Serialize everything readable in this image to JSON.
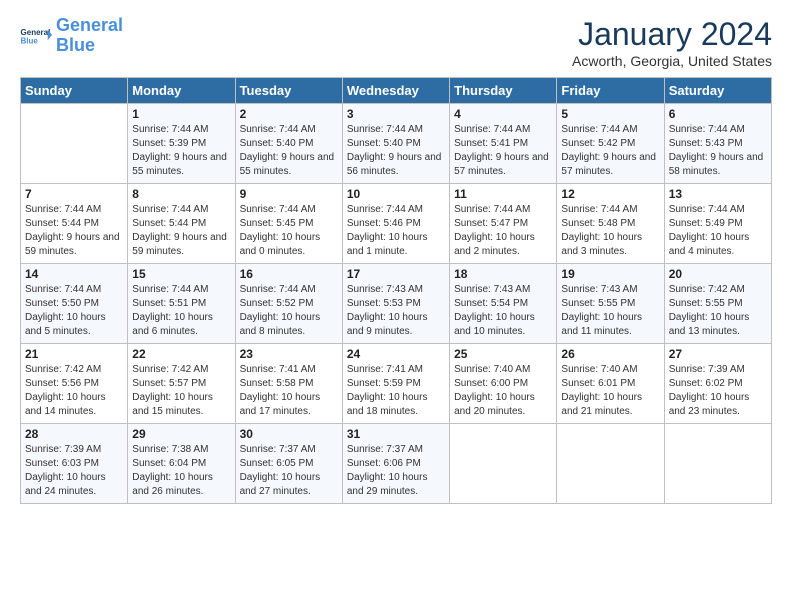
{
  "header": {
    "logo_line1": "General",
    "logo_line2": "Blue",
    "month_title": "January 2024",
    "location": "Acworth, Georgia, United States"
  },
  "weekdays": [
    "Sunday",
    "Monday",
    "Tuesday",
    "Wednesday",
    "Thursday",
    "Friday",
    "Saturday"
  ],
  "weeks": [
    [
      {
        "day": "",
        "sunrise": "",
        "sunset": "",
        "daylight": ""
      },
      {
        "day": "1",
        "sunrise": "Sunrise: 7:44 AM",
        "sunset": "Sunset: 5:39 PM",
        "daylight": "Daylight: 9 hours and 55 minutes."
      },
      {
        "day": "2",
        "sunrise": "Sunrise: 7:44 AM",
        "sunset": "Sunset: 5:40 PM",
        "daylight": "Daylight: 9 hours and 55 minutes."
      },
      {
        "day": "3",
        "sunrise": "Sunrise: 7:44 AM",
        "sunset": "Sunset: 5:40 PM",
        "daylight": "Daylight: 9 hours and 56 minutes."
      },
      {
        "day": "4",
        "sunrise": "Sunrise: 7:44 AM",
        "sunset": "Sunset: 5:41 PM",
        "daylight": "Daylight: 9 hours and 57 minutes."
      },
      {
        "day": "5",
        "sunrise": "Sunrise: 7:44 AM",
        "sunset": "Sunset: 5:42 PM",
        "daylight": "Daylight: 9 hours and 57 minutes."
      },
      {
        "day": "6",
        "sunrise": "Sunrise: 7:44 AM",
        "sunset": "Sunset: 5:43 PM",
        "daylight": "Daylight: 9 hours and 58 minutes."
      }
    ],
    [
      {
        "day": "7",
        "sunrise": "Sunrise: 7:44 AM",
        "sunset": "Sunset: 5:44 PM",
        "daylight": "Daylight: 9 hours and 59 minutes."
      },
      {
        "day": "8",
        "sunrise": "Sunrise: 7:44 AM",
        "sunset": "Sunset: 5:44 PM",
        "daylight": "Daylight: 9 hours and 59 minutes."
      },
      {
        "day": "9",
        "sunrise": "Sunrise: 7:44 AM",
        "sunset": "Sunset: 5:45 PM",
        "daylight": "Daylight: 10 hours and 0 minutes."
      },
      {
        "day": "10",
        "sunrise": "Sunrise: 7:44 AM",
        "sunset": "Sunset: 5:46 PM",
        "daylight": "Daylight: 10 hours and 1 minute."
      },
      {
        "day": "11",
        "sunrise": "Sunrise: 7:44 AM",
        "sunset": "Sunset: 5:47 PM",
        "daylight": "Daylight: 10 hours and 2 minutes."
      },
      {
        "day": "12",
        "sunrise": "Sunrise: 7:44 AM",
        "sunset": "Sunset: 5:48 PM",
        "daylight": "Daylight: 10 hours and 3 minutes."
      },
      {
        "day": "13",
        "sunrise": "Sunrise: 7:44 AM",
        "sunset": "Sunset: 5:49 PM",
        "daylight": "Daylight: 10 hours and 4 minutes."
      }
    ],
    [
      {
        "day": "14",
        "sunrise": "Sunrise: 7:44 AM",
        "sunset": "Sunset: 5:50 PM",
        "daylight": "Daylight: 10 hours and 5 minutes."
      },
      {
        "day": "15",
        "sunrise": "Sunrise: 7:44 AM",
        "sunset": "Sunset: 5:51 PM",
        "daylight": "Daylight: 10 hours and 6 minutes."
      },
      {
        "day": "16",
        "sunrise": "Sunrise: 7:44 AM",
        "sunset": "Sunset: 5:52 PM",
        "daylight": "Daylight: 10 hours and 8 minutes."
      },
      {
        "day": "17",
        "sunrise": "Sunrise: 7:43 AM",
        "sunset": "Sunset: 5:53 PM",
        "daylight": "Daylight: 10 hours and 9 minutes."
      },
      {
        "day": "18",
        "sunrise": "Sunrise: 7:43 AM",
        "sunset": "Sunset: 5:54 PM",
        "daylight": "Daylight: 10 hours and 10 minutes."
      },
      {
        "day": "19",
        "sunrise": "Sunrise: 7:43 AM",
        "sunset": "Sunset: 5:55 PM",
        "daylight": "Daylight: 10 hours and 11 minutes."
      },
      {
        "day": "20",
        "sunrise": "Sunrise: 7:42 AM",
        "sunset": "Sunset: 5:55 PM",
        "daylight": "Daylight: 10 hours and 13 minutes."
      }
    ],
    [
      {
        "day": "21",
        "sunrise": "Sunrise: 7:42 AM",
        "sunset": "Sunset: 5:56 PM",
        "daylight": "Daylight: 10 hours and 14 minutes."
      },
      {
        "day": "22",
        "sunrise": "Sunrise: 7:42 AM",
        "sunset": "Sunset: 5:57 PM",
        "daylight": "Daylight: 10 hours and 15 minutes."
      },
      {
        "day": "23",
        "sunrise": "Sunrise: 7:41 AM",
        "sunset": "Sunset: 5:58 PM",
        "daylight": "Daylight: 10 hours and 17 minutes."
      },
      {
        "day": "24",
        "sunrise": "Sunrise: 7:41 AM",
        "sunset": "Sunset: 5:59 PM",
        "daylight": "Daylight: 10 hours and 18 minutes."
      },
      {
        "day": "25",
        "sunrise": "Sunrise: 7:40 AM",
        "sunset": "Sunset: 6:00 PM",
        "daylight": "Daylight: 10 hours and 20 minutes."
      },
      {
        "day": "26",
        "sunrise": "Sunrise: 7:40 AM",
        "sunset": "Sunset: 6:01 PM",
        "daylight": "Daylight: 10 hours and 21 minutes."
      },
      {
        "day": "27",
        "sunrise": "Sunrise: 7:39 AM",
        "sunset": "Sunset: 6:02 PM",
        "daylight": "Daylight: 10 hours and 23 minutes."
      }
    ],
    [
      {
        "day": "28",
        "sunrise": "Sunrise: 7:39 AM",
        "sunset": "Sunset: 6:03 PM",
        "daylight": "Daylight: 10 hours and 24 minutes."
      },
      {
        "day": "29",
        "sunrise": "Sunrise: 7:38 AM",
        "sunset": "Sunset: 6:04 PM",
        "daylight": "Daylight: 10 hours and 26 minutes."
      },
      {
        "day": "30",
        "sunrise": "Sunrise: 7:37 AM",
        "sunset": "Sunset: 6:05 PM",
        "daylight": "Daylight: 10 hours and 27 minutes."
      },
      {
        "day": "31",
        "sunrise": "Sunrise: 7:37 AM",
        "sunset": "Sunset: 6:06 PM",
        "daylight": "Daylight: 10 hours and 29 minutes."
      },
      {
        "day": "",
        "sunrise": "",
        "sunset": "",
        "daylight": ""
      },
      {
        "day": "",
        "sunrise": "",
        "sunset": "",
        "daylight": ""
      },
      {
        "day": "",
        "sunrise": "",
        "sunset": "",
        "daylight": ""
      }
    ]
  ]
}
